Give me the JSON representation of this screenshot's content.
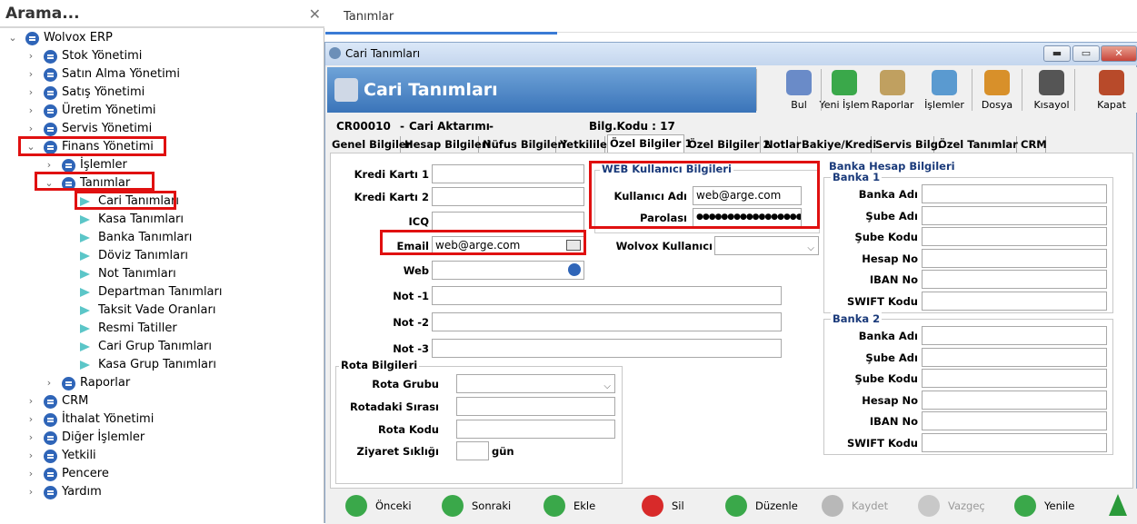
{
  "search": {
    "placeholder": "Arama...",
    "clear": "✕"
  },
  "tree": {
    "root": "Wolvox ERP",
    "items": [
      "Stok Yönetimi",
      "Satın Alma Yönetimi",
      "Satış Yönetimi",
      "Üretim Yönetimi",
      "Servis Yönetimi",
      "Finans Yönetimi",
      "İşlemler",
      "Tanımlar",
      "Cari Tanımları",
      "Kasa Tanımları",
      "Banka Tanımları",
      "Döviz Tanımları",
      "Not Tanımları",
      "Departman Tanımları",
      "Taksit Vade Oranları",
      "Resmi Tatiller",
      "Cari Grup Tanımları",
      "Kasa Grup Tanımları",
      "Raporlar",
      "CRM",
      "İthalat Yönetimi",
      "Diğer İşlemler",
      "Yetkili",
      "Pencere",
      "Yardım"
    ]
  },
  "header": {
    "title": "Tanımlar"
  },
  "window": {
    "title": "Cari Tanımları",
    "banner": "Cari Tanımları",
    "min": "▬",
    "max": "▭",
    "close": "✕"
  },
  "toolbar": [
    "Bul",
    "Yeni İşlem",
    "Raporlar",
    "İşlemler",
    "Dosya",
    "Kısayol",
    "Kapat"
  ],
  "info": {
    "code": "CR00010",
    "name": "Cari Aktarımı",
    "dash1": "-",
    "dash2": "-",
    "bilg": "Bilg.Kodu : 17"
  },
  "tabs": [
    "Genel Bilgiler",
    "Hesap Bilgileri",
    "Nüfus Bilgileri",
    "Yetkililer",
    "Özel Bilgiler 1",
    "Özel Bilgiler 2",
    "Notlar",
    "Bakiye/Kredi",
    "Servis Bilg.",
    "Özel Tanımlar",
    "CRM"
  ],
  "form": {
    "kredi1": "Kredi Kartı 1",
    "kredi2": "Kredi Kartı 2",
    "icq": "ICQ",
    "email": "Email",
    "email_val": "web@arge.com",
    "web": "Web",
    "not1": "Not -1",
    "not2": "Not -2",
    "not3": "Not -3",
    "rota_title": "Rota Bilgileri",
    "rota_grubu": "Rota Grubu",
    "rota_sira": "Rotadaki Sırası",
    "rota_kodu": "Rota Kodu",
    "ziyaret": "Ziyaret Sıklığı",
    "gun": "gün",
    "web_title": "WEB Kullanıcı Bilgileri",
    "kullanici": "Kullanıcı Adı",
    "kullanici_val": "web@arge.com",
    "parola": "Parolası",
    "parola_val": "●●●●●●●●●●●●●●●●●",
    "wolvox_user": "Wolvox Kullanıcı",
    "banka_title": "Banka Hesap Bilgileri",
    "banka1": "Banka 1",
    "banka2": "Banka 2",
    "bank_fields": [
      "Banka Adı",
      "Şube Adı",
      "Şube Kodu",
      "Hesap No",
      "IBAN No",
      "SWIFT Kodu"
    ]
  },
  "bottom": [
    "Önceki",
    "Sonraki",
    "Ekle",
    "Sil",
    "Düzenle",
    "Kaydet",
    "Vazgeç",
    "Yenile"
  ]
}
